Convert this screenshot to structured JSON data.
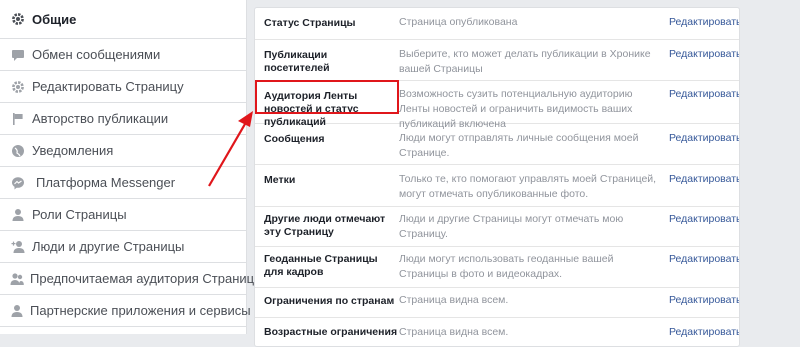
{
  "sidebar": {
    "items": [
      {
        "label": "Общие",
        "icon": "gear-icon"
      },
      {
        "label": "Обмен сообщениями",
        "icon": "chat-icon"
      },
      {
        "label": "Редактировать Страницу",
        "icon": "gear-icon"
      },
      {
        "label": "Авторство публикации",
        "icon": "flag-icon"
      },
      {
        "label": "Уведомления",
        "icon": "globe-icon"
      },
      {
        "label": "Платформа Messenger",
        "icon": "messenger-icon"
      },
      {
        "label": "Роли Страницы",
        "icon": "person-icon"
      },
      {
        "label": "Люди и другие Страницы",
        "icon": "person-add-icon"
      },
      {
        "label": "Предпочитаемая аудитория Страницы",
        "icon": "people-icon"
      },
      {
        "label": "Партнерские приложения и сервисы",
        "icon": "person-icon"
      }
    ]
  },
  "settings": {
    "edit_label": "Редактировать",
    "rows": [
      {
        "label": "Статус Страницы",
        "desc": "Страница опубликована"
      },
      {
        "label": "Публикации посетителей",
        "desc": "Выберите, кто может делать публикации в Хронике вашей Страницы"
      },
      {
        "label": "Аудитория Ленты новостей и статус публикаций",
        "desc": "Возможность сузить потенциальную аудиторию Ленты новостей и ограничить видимость ваших публикаций включена"
      },
      {
        "label": "Сообщения",
        "desc": "Люди могут отправлять личные сообщения моей Странице."
      },
      {
        "label": "Метки",
        "desc": "Только те, кто помогают управлять моей Страницей, могут отмечать опубликованные фото."
      },
      {
        "label": "Другие люди отмечают эту Страницу",
        "desc": "Люди и другие Страницы могут отмечать мою Страницу."
      },
      {
        "label": "Геоданные Страницы для кадров",
        "desc": "Люди могут использовать геоданные вашей Страницы в фото и видеокадрах."
      },
      {
        "label": "Ограничения по странам",
        "desc": "Страница видна всем."
      },
      {
        "label": "Возрастные ограничения",
        "desc": "Страница видна всем."
      }
    ]
  },
  "colors": {
    "accent": "#365899",
    "highlight": "#e0161b"
  }
}
